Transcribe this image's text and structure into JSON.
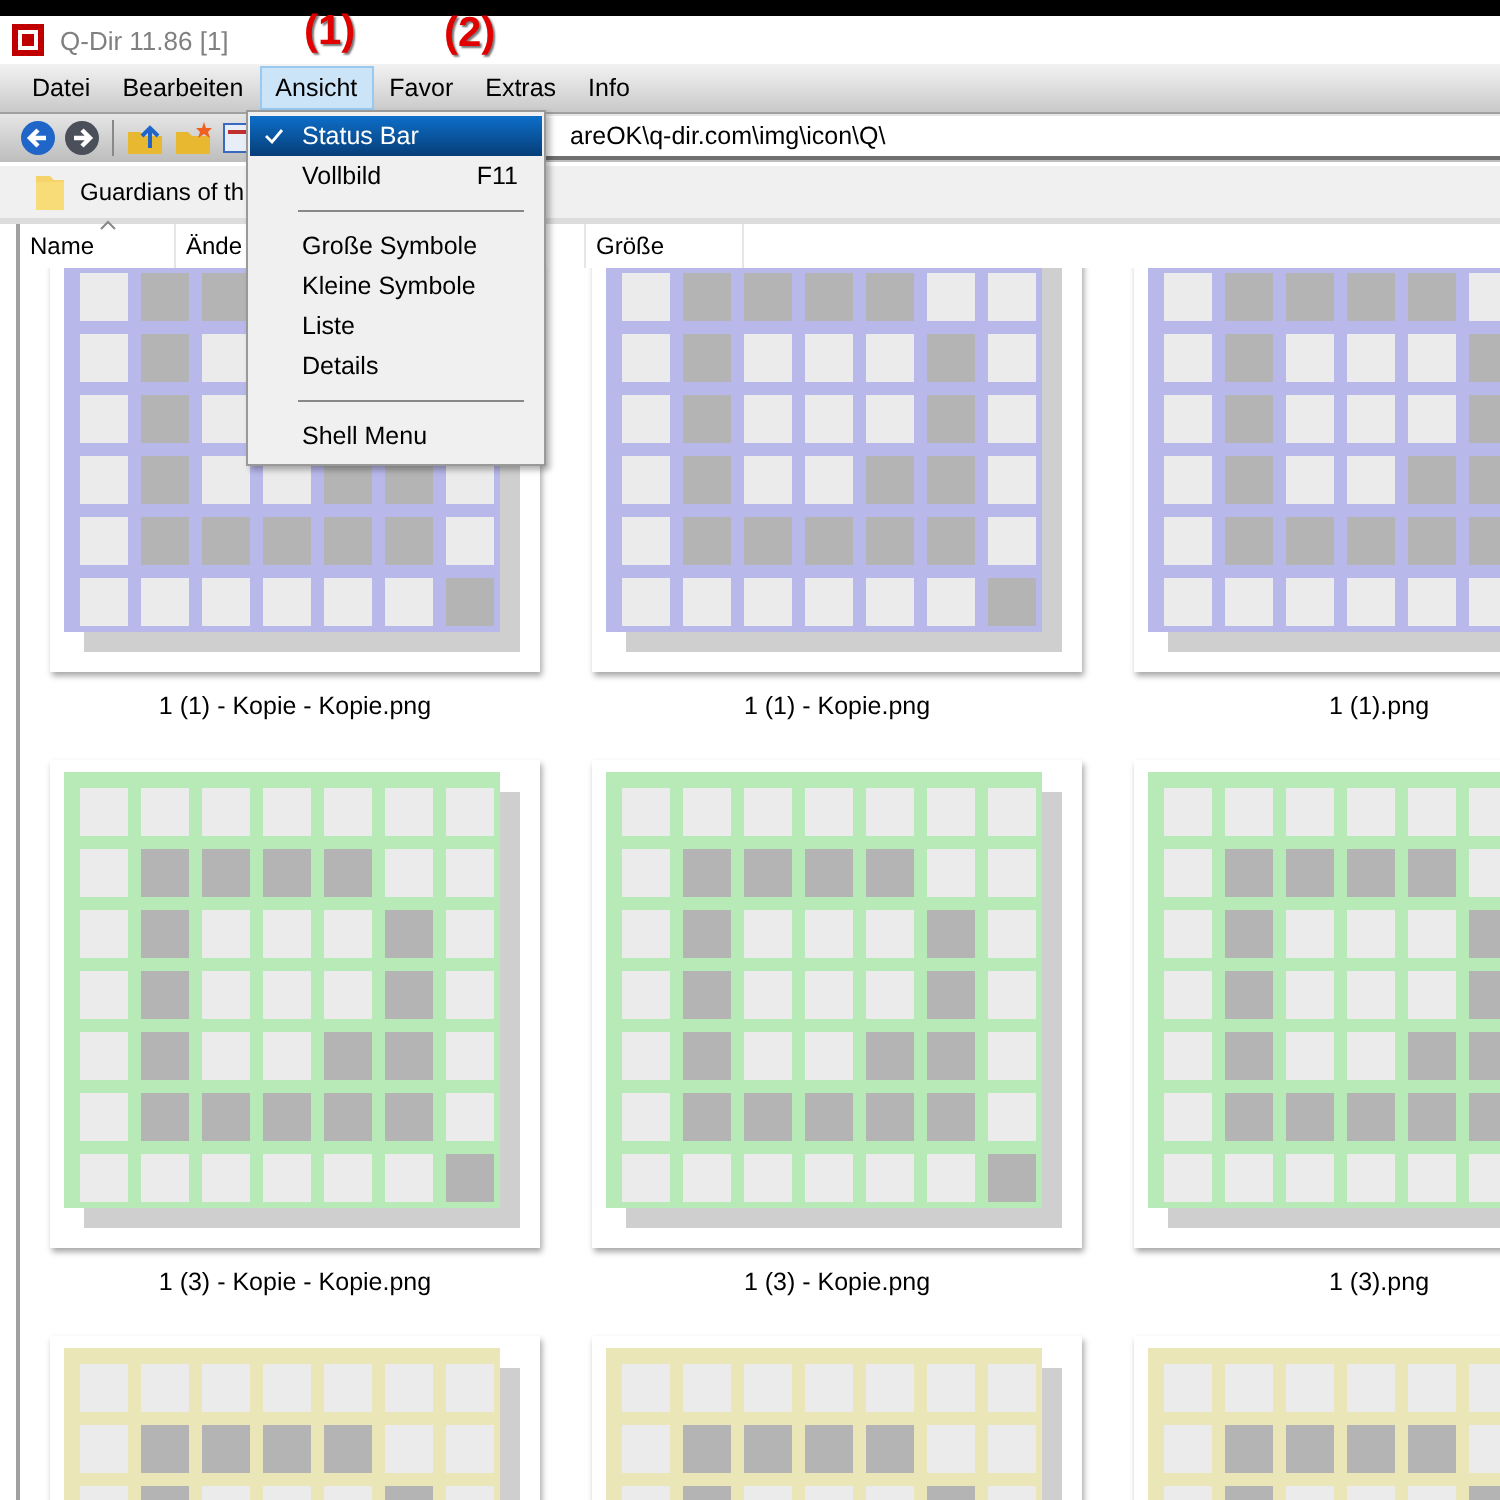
{
  "window": {
    "title": "Q-Dir 11.86 [1]"
  },
  "annotations": [
    {
      "label": "(1)"
    },
    {
      "label": "(2)"
    }
  ],
  "menu_bar": [
    {
      "label": "Datei",
      "selected": false
    },
    {
      "label": "Bearbeiten",
      "selected": false
    },
    {
      "label": "Ansicht",
      "selected": true
    },
    {
      "label": "Favor",
      "selected": false
    },
    {
      "label": "Extras",
      "selected": false
    },
    {
      "label": "Info",
      "selected": false
    }
  ],
  "address_bar": {
    "value": "areOK\\q-dir.com\\img\\icon\\Q\\"
  },
  "tab": {
    "label": "Guardians of th"
  },
  "columns": [
    {
      "label": "Name",
      "sorted": true
    },
    {
      "label": "Ände",
      "sorted": false
    },
    {
      "label": "Größe",
      "sorted": false
    }
  ],
  "file_rows": [
    {
      "items": [
        {
          "name": "1 (1) - Kopie - Kopie.png",
          "color": "#b8b8ea"
        },
        {
          "name": "1 (1) - Kopie.png",
          "color": "#b8b8ea"
        },
        {
          "name": "1 (1).png",
          "color": "#b8b8ea"
        }
      ]
    },
    {
      "items": [
        {
          "name": "1 (3) - Kopie - Kopie.png",
          "color": "#b8eab8"
        },
        {
          "name": "1 (3) - Kopie.png",
          "color": "#b8eab8"
        },
        {
          "name": "1 (3).png",
          "color": "#b8eab8"
        }
      ]
    },
    {
      "items": [
        {
          "color": "#eae6b8"
        },
        {
          "color": "#eae6b8"
        },
        {
          "color": "#eae6b8"
        }
      ]
    }
  ],
  "dropdown_menu": {
    "items": [
      {
        "kind": "item",
        "label": "Status Bar",
        "checked": true,
        "selected": true
      },
      {
        "kind": "item",
        "label": "Vollbild",
        "shortcut": "F11",
        "checked": false,
        "selected": false
      },
      {
        "kind": "separator"
      },
      {
        "kind": "item",
        "label": "Große Symbole",
        "checked": false,
        "selected": false
      },
      {
        "kind": "item",
        "label": "Kleine Symbole",
        "checked": false,
        "selected": false
      },
      {
        "kind": "item",
        "label": "Liste",
        "checked": false,
        "selected": false
      },
      {
        "kind": "item",
        "label": "Details",
        "checked": false,
        "selected": false
      },
      {
        "kind": "separator"
      },
      {
        "kind": "item",
        "label": "Shell Menu",
        "checked": false,
        "selected": false
      }
    ]
  }
}
